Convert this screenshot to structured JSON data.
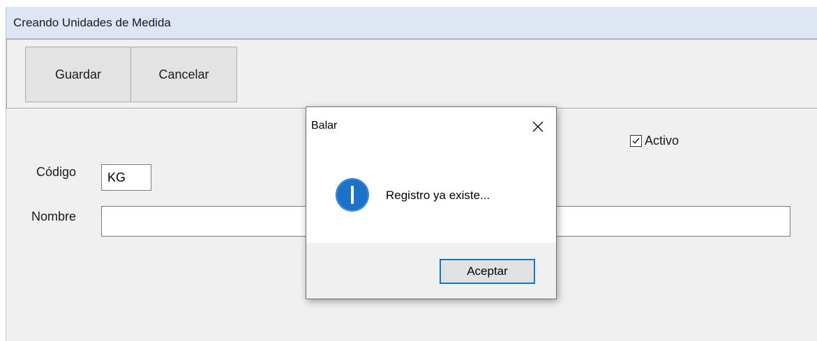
{
  "window": {
    "title": "Creando Unidades de Medida"
  },
  "toolbar": {
    "save_label": "Guardar",
    "cancel_label": "Cancelar"
  },
  "form": {
    "codigo_label": "Código",
    "codigo_value": "KG",
    "nombre_label": "Nombre",
    "nombre_value": "",
    "activo_label": "Activo",
    "activo_checked": true
  },
  "dialog": {
    "title": "Balar",
    "message": "Registro ya existe...",
    "ok_label": "Aceptar",
    "icon": "info-icon",
    "close_icon": "close-icon"
  },
  "colors": {
    "title_bar_bg": "#dde6f2",
    "info_icon_blue": "#1a73c9",
    "dialog_button_focus": "#0078d7",
    "window_bg": "#f0f0f0"
  }
}
